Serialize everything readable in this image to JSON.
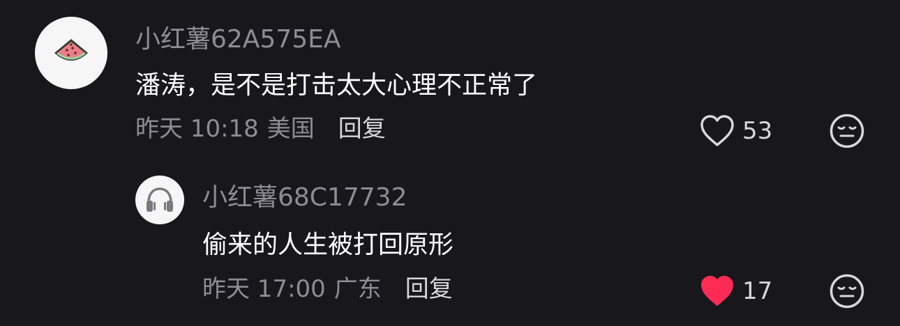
{
  "comments": [
    {
      "username": "小红薯62A575EA",
      "content": "潘涛，是不是打击太大心理不正常了",
      "time": "昨天 10:18",
      "location": "美国",
      "reply_label": "回复",
      "like_count": "53",
      "liked": false,
      "avatar_icon": "watermelon-icon"
    },
    {
      "username": "小红薯68C17732",
      "content": "偷来的人生被打回原形",
      "time": "昨天 17:00",
      "location": "广东",
      "reply_label": "回复",
      "like_count": "17",
      "liked": true,
      "avatar_icon": "headphones-icon"
    }
  ],
  "colors": {
    "background": "#18171c",
    "liked_heart": "#fe2c55",
    "muted_text": "#8e8d93"
  }
}
